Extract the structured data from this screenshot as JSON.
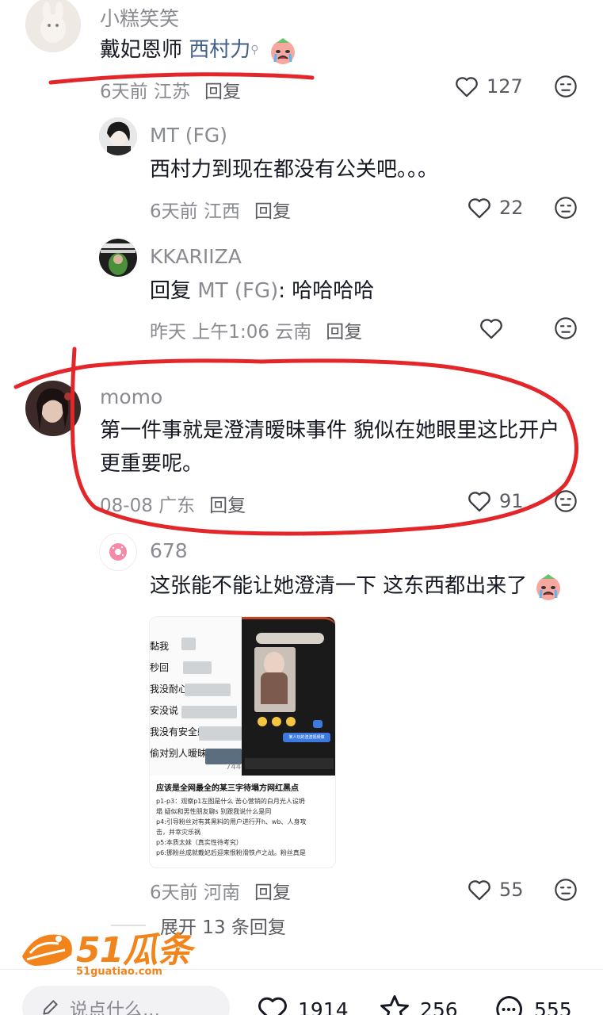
{
  "comments": [
    {
      "username": "小糕笑笑",
      "text_prefix": "戴妃恩师 ",
      "text_link": "西村力",
      "meta": "6天前 江苏",
      "reply": "回复",
      "likes": "127"
    },
    {
      "username": "MT (FG)",
      "text": "西村力到现在都没有公关吧。。。",
      "meta": "6天前 江西",
      "reply": "回复",
      "likes": "22"
    },
    {
      "username": "KKARIIZA",
      "text_prefix": "回复 ",
      "text_mention": "MT (FG)",
      "text_suffix": ": 哈哈哈哈",
      "meta": "昨天 上午1:06 云南",
      "reply": "回复",
      "likes": ""
    },
    {
      "username": "momo",
      "text": "第一件事就是澄清暧昧事件 貌似在她眼里这比开户更重要呢。",
      "meta": "08-08 广东",
      "reply": "回复",
      "likes": "91"
    },
    {
      "username": "678",
      "text": "这张能不能让她澄清一下 这东西都出来了",
      "meta": "6天前 河南",
      "reply": "回复",
      "likes": "55"
    }
  ],
  "thumbnail": {
    "left_lines": [
      "黏我",
      "秒回",
      "我没耐心",
      "安没说",
      "我没有安全感",
      "偷对别人暧昧"
    ],
    "number": "7446",
    "title": "应该是全网最全的某三字待塌方网红黑点",
    "lines": [
      "p1-p3：观察p1左图是什么 苦心营销的白月光人设坍",
      "塌 疑似和男性朋友聊s 别跟我说什么是同",
      "p4:引导粉丝对有其黑料的用户进行开h、wb、人身攻",
      "击，并幸灾乐祸",
      "p5:本质太妹（真实性待考究）",
      "p6:挪粉丝成就戴妃后迎来恨粉滑铁卢之战。粉丝真是"
    ],
    "chat_bubble": "某人玩的渣渣视频做"
  },
  "expand": "展开 13 条回复",
  "bottom_bar": {
    "input_placeholder": "说点什么...",
    "likes": "1914",
    "favorites": "256",
    "comments": "555"
  },
  "watermark": {
    "brand": "51瓜条",
    "url": "51guatiao.com"
  },
  "colors": {
    "annotation_red": "#e3262a",
    "link": "#3f5e8a",
    "watermark_orange": "#f2841c"
  }
}
